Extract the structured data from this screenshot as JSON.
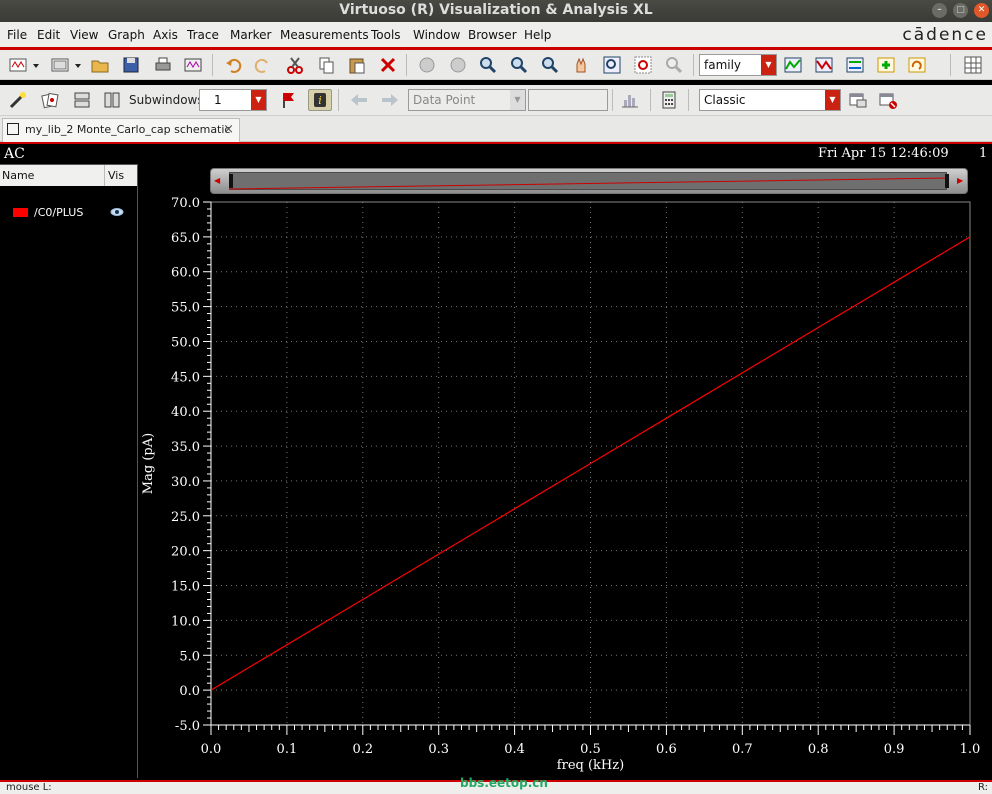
{
  "window": {
    "title": "Virtuoso (R) Visualization & Analysis XL"
  },
  "brand": "cādence",
  "menu": [
    "File",
    "Edit",
    "View",
    "Graph",
    "Axis",
    "Trace",
    "Marker",
    "Measurements",
    "Tools",
    "Window",
    "Browser",
    "Help"
  ],
  "toolbar1": {
    "family_combo": "family",
    "icons": [
      "new-window-icon",
      "new-subwindow-icon",
      "open-icon",
      "save-icon",
      "print-icon",
      "print-preview-icon",
      "undo-icon",
      "redo-icon",
      "cut-icon",
      "copy-icon",
      "paste-icon",
      "delete-icon",
      "zoom-fit-icon",
      "zoom-in-icon",
      "zoom-out-icon",
      "zoom-x-icon",
      "zoom-y-icon",
      "pan-icon",
      "zoom-box-icon",
      "zoom-region-icon",
      "zoom-reset-icon",
      "family-plot-icon"
    ]
  },
  "toolbar2": {
    "subwindows_label": "Subwindows:",
    "subwindows_value": "1",
    "datapoint_combo": "Data Point",
    "classic_combo": "Classic"
  },
  "tab": {
    "label": "my_lib_2 Monte_Carlo_cap schematic"
  },
  "graph": {
    "analysis_label": "AC",
    "date": "Fri Apr 15 12:46:09",
    "page_number": "1"
  },
  "trace_panel": {
    "name_header": "Name",
    "vis_header": "Vis",
    "traces": [
      {
        "name": "/C0/PLUS",
        "color": "#ff0000"
      }
    ]
  },
  "chart_data": {
    "type": "line",
    "xlabel": "freq (kHz)",
    "ylabel": "Mag (pA)",
    "xlim": [
      0.0,
      1.0
    ],
    "ylim": [
      -5.0,
      70.0
    ],
    "x_ticks": [
      "0.0",
      "0.1",
      "0.2",
      "0.3",
      "0.4",
      "0.5",
      "0.6",
      "0.7",
      "0.8",
      "0.9",
      "1.0"
    ],
    "y_ticks": [
      "-5.0",
      "0.0",
      "5.0",
      "10.0",
      "15.0",
      "20.0",
      "25.0",
      "30.0",
      "35.0",
      "40.0",
      "45.0",
      "50.0",
      "55.0",
      "60.0",
      "65.0",
      "70.0"
    ],
    "grid": true,
    "series": [
      {
        "name": "/C0/PLUS",
        "color": "#ff0000",
        "x": [
          0.0,
          0.1,
          0.2,
          0.3,
          0.4,
          0.5,
          0.6,
          0.7,
          0.8,
          0.9,
          1.0
        ],
        "y": [
          0.0,
          6.5,
          13.0,
          19.5,
          26.0,
          32.5,
          39.0,
          45.5,
          52.0,
          58.5,
          65.0
        ]
      }
    ]
  },
  "statusbar": {
    "left": "mouse L:",
    "right": "R:"
  },
  "watermark": "bbs.eetop.cn"
}
